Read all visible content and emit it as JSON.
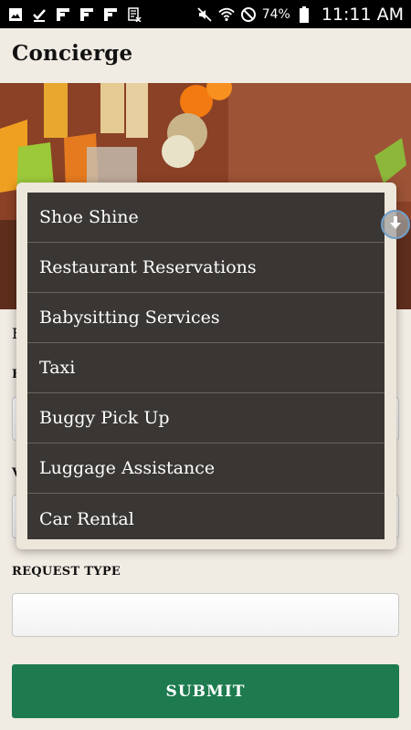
{
  "status_bar": {
    "battery_percent": "74%",
    "time": "11:11 AM",
    "icons": [
      "image-icon",
      "download-done-icon",
      "flipboard-icon",
      "flipboard-icon",
      "flipboard-icon",
      "news-icon",
      "mute-icon",
      "wifi-icon",
      "dnd-icon",
      "battery-icon"
    ]
  },
  "header": {
    "title": "Concierge"
  },
  "form": {
    "partial_text": "F",
    "label_1": "F",
    "label_2": "V",
    "request_type_label": "REQUEST TYPE",
    "submit_label": "SUBMIT"
  },
  "dropdown": {
    "options": [
      "Shoe Shine",
      "Restaurant Reservations",
      "Babysitting Services",
      "Taxi",
      "Buggy Pick Up",
      "Luggage Assistance",
      "Car Rental"
    ]
  },
  "colors": {
    "accent": "#1e7b4f",
    "list_bg": "#3a3633",
    "page_bg": "#f0ebe3"
  }
}
